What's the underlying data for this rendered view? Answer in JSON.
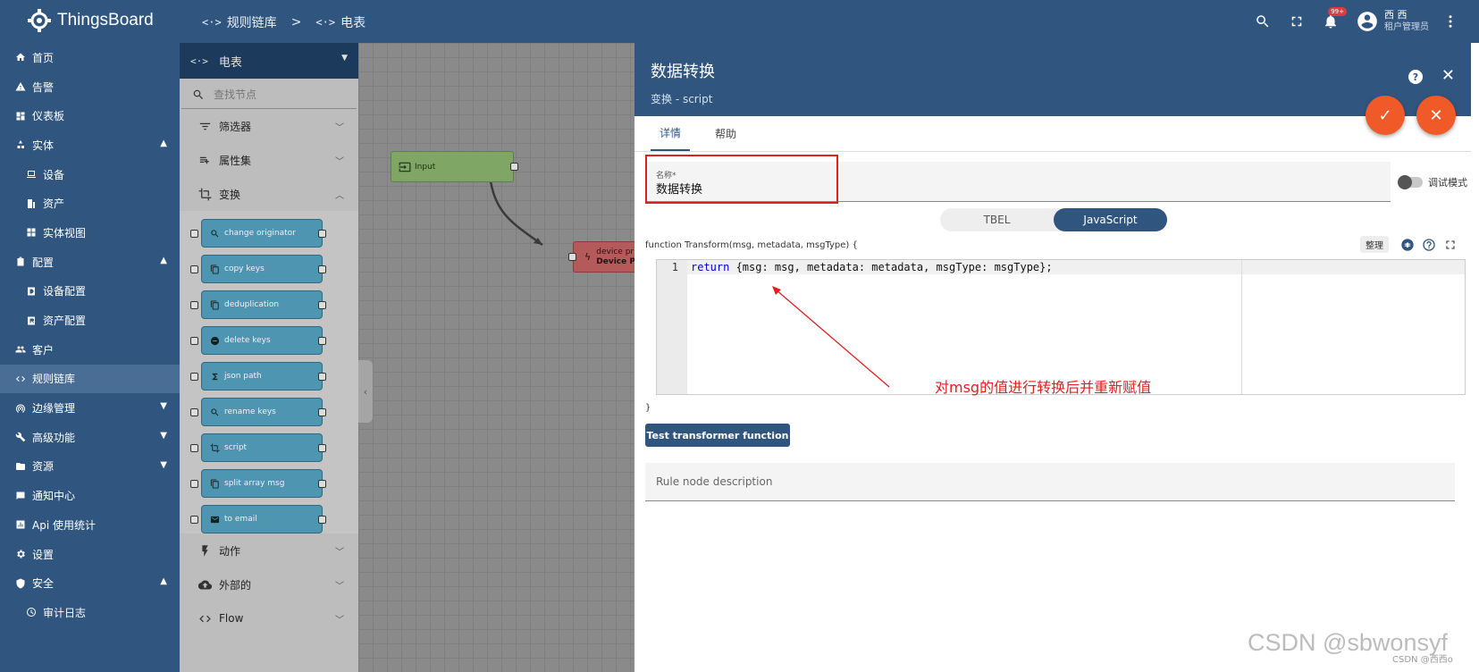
{
  "app": {
    "logo_text": "ThingsBoard"
  },
  "breadcrumb": [
    {
      "label": "规则链库"
    },
    {
      "label": "电表"
    }
  ],
  "breadcrumb_separator": ">",
  "topbar": {
    "notifications_badge": "99+",
    "user_name": "西 西",
    "user_role": "租户管理员"
  },
  "sidebar": {
    "items": [
      {
        "label": "首页",
        "icon": "home-icon"
      },
      {
        "label": "告警",
        "icon": "warning-icon"
      },
      {
        "label": "仪表板",
        "icon": "dashboard-icon"
      },
      {
        "label": "实体",
        "icon": "entities-icon",
        "expanded": true
      },
      {
        "label": "设备",
        "icon": "device-icon",
        "sub": true
      },
      {
        "label": "资产",
        "icon": "asset-icon",
        "sub": true
      },
      {
        "label": "实体视图",
        "icon": "view-icon",
        "sub": true
      },
      {
        "label": "配置",
        "icon": "profiles-icon",
        "expanded": true
      },
      {
        "label": "设备配置",
        "icon": "device-profile-icon",
        "sub": true
      },
      {
        "label": "资产配置",
        "icon": "asset-profile-icon",
        "sub": true
      },
      {
        "label": "客户",
        "icon": "customers-icon"
      },
      {
        "label": "规则链库",
        "icon": "rule-chain-icon",
        "active": true
      },
      {
        "label": "边缘管理",
        "icon": "edge-icon",
        "collapsed": true
      },
      {
        "label": "高级功能",
        "icon": "tools-icon",
        "collapsed": true
      },
      {
        "label": "资源",
        "icon": "folder-icon",
        "collapsed": true
      },
      {
        "label": "通知中心",
        "icon": "notification-center-icon"
      },
      {
        "label": "Api 使用统计",
        "icon": "api-usage-icon"
      },
      {
        "label": "设置",
        "icon": "settings-icon"
      },
      {
        "label": "安全",
        "icon": "security-icon",
        "expanded": true
      },
      {
        "label": "审计日志",
        "icon": "audit-log-icon",
        "sub": true
      }
    ]
  },
  "library": {
    "chain_name": "电表",
    "search_placeholder": "查找节点",
    "sections_top": [
      {
        "label": "筛选器",
        "icon": "filter-icon"
      },
      {
        "label": "属性集",
        "icon": "enrichment-icon"
      },
      {
        "label": "变换",
        "icon": "transform-icon",
        "expanded": true
      }
    ],
    "nodes": [
      {
        "label": "change originator",
        "icon": "search-icon"
      },
      {
        "label": "copy keys",
        "icon": "copy-icon"
      },
      {
        "label": "deduplication",
        "icon": "copy-icon"
      },
      {
        "label": "delete keys",
        "icon": "delete-icon"
      },
      {
        "label": "json path",
        "icon": "sigma-icon"
      },
      {
        "label": "rename keys",
        "icon": "search-icon"
      },
      {
        "label": "script",
        "icon": "transform-icon"
      },
      {
        "label": "split array msg",
        "icon": "copy-icon"
      },
      {
        "label": "to email",
        "icon": "email-icon"
      }
    ],
    "sections_bottom": [
      {
        "label": "动作",
        "icon": "flash-icon"
      },
      {
        "label": "外部的",
        "icon": "cloud-icon"
      },
      {
        "label": "Flow",
        "icon": "code-icon"
      }
    ]
  },
  "canvas": {
    "input_node": "Input",
    "device_node_line1": "device pr",
    "device_node_line2": "Device Pr"
  },
  "dialog": {
    "title": "数据转换",
    "subtitle": "变换 - script",
    "tabs": [
      {
        "label": "详情",
        "active": true
      },
      {
        "label": "帮助"
      }
    ],
    "name_label": "名称*",
    "name_value": "数据转换",
    "debug_mode_label": "调试模式",
    "script_lang_options": [
      {
        "label": "TBEL"
      },
      {
        "label": "JavaScript",
        "active": true
      }
    ],
    "function_signature": "function Transform(msg, metadata, msgType) {",
    "tidy_label": "整理",
    "code_line_number": "1",
    "code_keyword": "return",
    "code_rest": " {msg: msg, metadata: metadata, msgType: msgType};",
    "function_close": "}",
    "test_button": "Test transformer function",
    "description_placeholder": "Rule node description",
    "annotation": "对msg的值进行转换后并重新赋值"
  },
  "watermark": {
    "main": "CSDN @sbwonsyf",
    "small": "CSDN @西西o"
  },
  "colors": {
    "primary": "#305680",
    "accent": "#f05a28",
    "annotation_red": "#e02020"
  }
}
